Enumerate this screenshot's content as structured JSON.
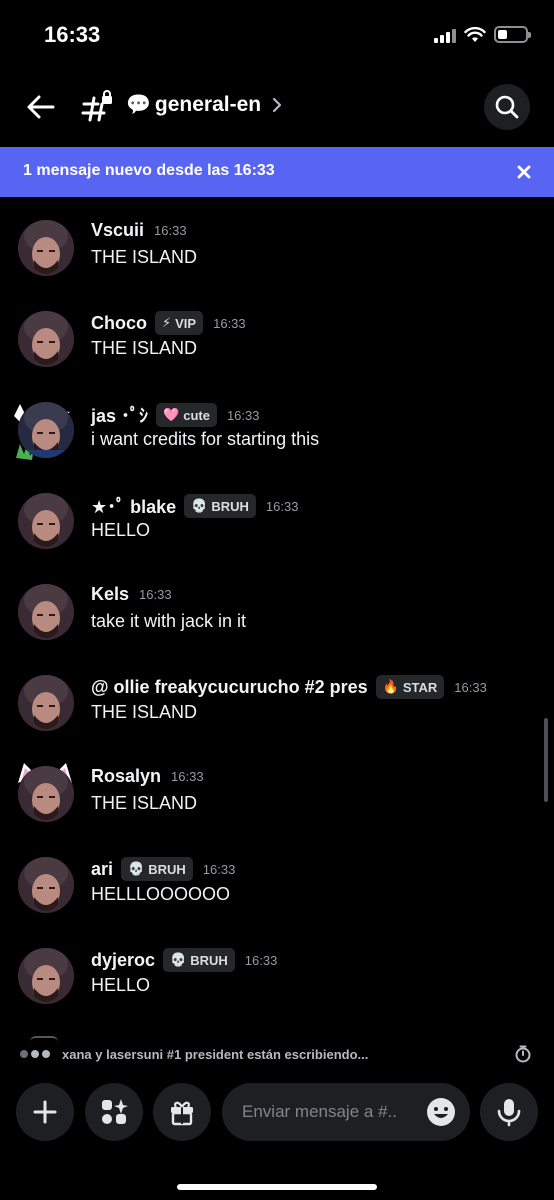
{
  "status_bar": {
    "time": "16:33"
  },
  "header": {
    "channel_emoji": "💬",
    "channel_name": "general-en"
  },
  "banner": {
    "text": "1 mensaje nuevo desde las 16:33"
  },
  "messages": [
    {
      "user": "Vscuii",
      "time": "16:33",
      "text": "THE ISLAND"
    },
    {
      "user": "Choco",
      "tag_icon": "⚡",
      "tag": "VIP",
      "time": "16:33",
      "text": "THE ISLAND"
    },
    {
      "user": "jas ･ﾟｼ",
      "tag_icon": "🩷",
      "tag": "cute",
      "time": "16:33",
      "text": "i want credits for starting this"
    },
    {
      "user": "★･ﾟ blake",
      "tag_icon": "💀",
      "tag": "BRUH",
      "time": "16:33",
      "text": "HELLO"
    },
    {
      "user": "Kels",
      "time": "16:33",
      "text": "take it with jack in it"
    },
    {
      "user": "@ ollie freakycucurucho #2 pres",
      "tag_icon": "🔥",
      "tag": "STAR",
      "time": "16:33",
      "text": "THE ISLAND"
    },
    {
      "user": "Rosalyn",
      "time": "16:33",
      "text": "THE ISLAND"
    },
    {
      "user": "ari",
      "tag_icon": "💀",
      "tag": "BRUH",
      "time": "16:33",
      "text": "HELLLOOOOOO"
    },
    {
      "user": "dyjeroc",
      "tag_icon": "💀",
      "tag": "BRUH",
      "time": "16:33",
      "text": "HELLO"
    }
  ],
  "typing": {
    "text": "xana y lasersuni #1 president están escribiendo..."
  },
  "composer": {
    "placeholder": "Enviar mensaje a #.."
  },
  "colors": {
    "banner": "#5865f2",
    "background": "#000000",
    "surface": "#1e1f22"
  },
  "icons": [
    "back-arrow-icon",
    "channel-hashtag-lock-icon",
    "search-icon",
    "close-icon",
    "plus-icon",
    "apps-icon",
    "gift-icon",
    "emoji-icon",
    "microphone-icon",
    "slowmode-timer-icon"
  ]
}
